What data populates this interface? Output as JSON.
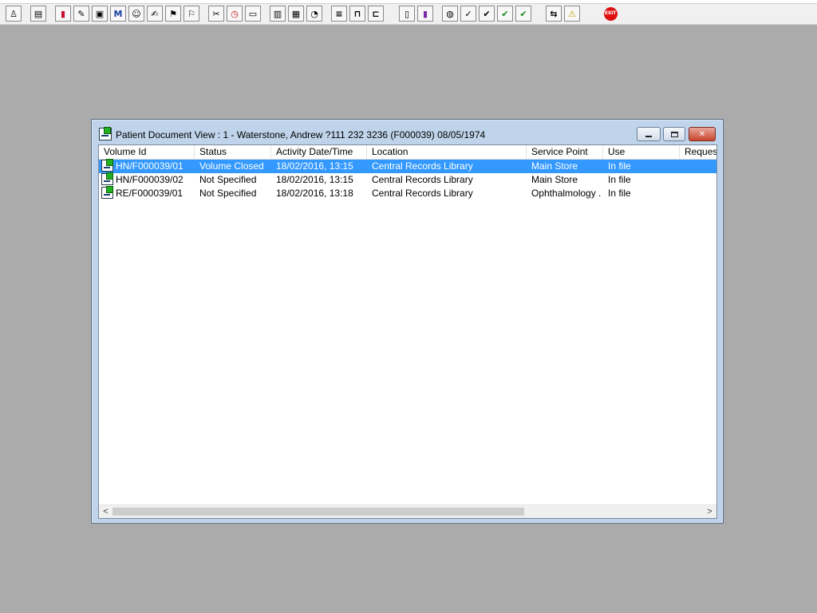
{
  "toolbar": {
    "buttons": [
      {
        "name": "patient-search",
        "icon": "patient-figure-icon",
        "glyph": "♙"
      },
      {
        "name": "print",
        "icon": "printer-icon",
        "glyph": "▤"
      },
      {
        "name": "book-red",
        "icon": "red-book-icon",
        "glyph": "▮"
      },
      {
        "name": "edit-book",
        "icon": "book-pencil-icon",
        "glyph": "✎"
      },
      {
        "name": "screen-view",
        "icon": "monitor-icon",
        "glyph": "▣"
      },
      {
        "name": "mail",
        "icon": "letter-m-icon",
        "glyph": "M"
      },
      {
        "name": "clinician",
        "icon": "person-icon",
        "glyph": "☺"
      },
      {
        "name": "notes",
        "icon": "notepad-icon",
        "glyph": "✍"
      },
      {
        "name": "flag-a",
        "icon": "flag-icon",
        "glyph": "⚑"
      },
      {
        "name": "flag-b",
        "icon": "flag-icon",
        "glyph": "⚐"
      },
      {
        "name": "tools",
        "icon": "tools-icon",
        "glyph": "✂"
      },
      {
        "name": "clock",
        "icon": "clock-icon",
        "glyph": "◷"
      },
      {
        "name": "terminal",
        "icon": "screen-icon",
        "glyph": "▭"
      },
      {
        "name": "card-a",
        "icon": "card-icon",
        "glyph": "▥"
      },
      {
        "name": "card-b",
        "icon": "card-icon",
        "glyph": "▦"
      },
      {
        "name": "timer",
        "icon": "stopwatch-icon",
        "glyph": "◔"
      },
      {
        "name": "note-yellow",
        "icon": "sticky-note-icon",
        "glyph": "≡"
      },
      {
        "name": "bed",
        "icon": "bed-icon",
        "glyph": "⊓"
      },
      {
        "name": "transport",
        "icon": "trolley-icon",
        "glyph": "⊏"
      },
      {
        "name": "document",
        "icon": "document-icon",
        "glyph": "▯"
      },
      {
        "name": "chart",
        "icon": "bar-chart-icon",
        "glyph": "▮"
      },
      {
        "name": "globe",
        "icon": "globe-icon",
        "glyph": "◍"
      },
      {
        "name": "doc-tick",
        "icon": "document-check-icon",
        "glyph": "✓"
      },
      {
        "name": "doc-check",
        "icon": "document-check-icon",
        "glyph": "✔"
      },
      {
        "name": "doc-green-a",
        "icon": "document-green-icon",
        "glyph": "✔"
      },
      {
        "name": "doc-green-b",
        "icon": "document-green-icon",
        "glyph": "✔"
      },
      {
        "name": "transfer",
        "icon": "swap-arrows-icon",
        "glyph": "⇆"
      },
      {
        "name": "warning",
        "icon": "warning-triangle-icon",
        "glyph": "⚠"
      }
    ],
    "exit_label": "EXIT"
  },
  "window": {
    "title": "Patient Document View : 1 - Waterstone, Andrew ?111 232 3236 (F000039) 08/05/1974"
  },
  "table": {
    "columns": [
      "Volume Id",
      "Status",
      "Activity Date/Time",
      "Location",
      "Service Point",
      "Use",
      "Request"
    ],
    "rows": [
      {
        "volume_id": "HN/F000039/01",
        "status": "Volume Closed",
        "activity": "18/02/2016, 13:15",
        "location": "Central Records Library",
        "service_point": "Main Store",
        "use": "In file",
        "request": "",
        "selected": true
      },
      {
        "volume_id": "HN/F000039/02",
        "status": "Not Specified",
        "activity": "18/02/2016, 13:15",
        "location": "Central Records Library",
        "service_point": "Main Store",
        "use": "In file",
        "request": "",
        "selected": false
      },
      {
        "volume_id": "RE/F000039/01",
        "status": "Not Specified",
        "activity": "18/02/2016, 13:18",
        "location": "Central Records Library",
        "service_point": "Ophthalmology ...",
        "use": "In file",
        "request": "",
        "selected": false
      }
    ]
  },
  "colors": {
    "desktop": "#ababab",
    "selection": "#3399ff",
    "window_frame": "#bfd4ea",
    "close_button": "#c8442e",
    "exit_button": "#e01010"
  }
}
